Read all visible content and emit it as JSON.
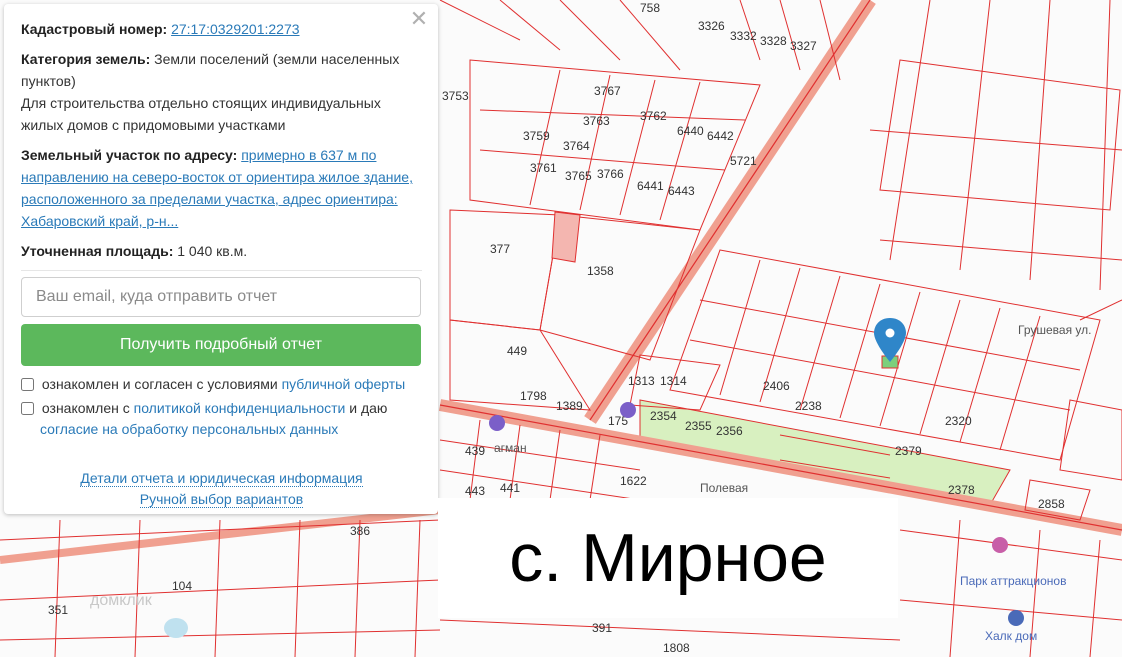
{
  "info_panel": {
    "cadastral_label": "Кадастровый номер:",
    "cadastral_number": "27:17:0329201:2273",
    "category_label": "Категория земель:",
    "category_value": "Земли поселений (земли населенных пунктов)",
    "usage": "Для строительства отдельно стоящих индивидуальных жилых домов с придомовыми участками",
    "address_label": "Земельный участок по адресу:",
    "address_link": "примерно в 637 м по направлению на северо-восток от ориентира жилое здание, расположенного за пределами участка, адрес ориентира: Хабаровский край, р-н...",
    "area_label": "Уточненная площадь:",
    "area_value": "1 040 кв.м.",
    "close_glyph": "✕"
  },
  "report_form": {
    "email_placeholder": "Ваш email, куда отправить отчет",
    "submit_label": "Получить подробный отчет",
    "consent1_text": "ознакомлен и согласен с условиями",
    "consent1_link": "публичной оферты",
    "consent2_text_a": "ознакомлен с",
    "consent2_link_a": "политикой конфиденциальности",
    "consent2_text_b": "и даю",
    "consent2_link_b": "согласие на обработку персональных данных"
  },
  "footer_links": {
    "details": "Детали отчета и юридическая информация",
    "manual": "Ручной выбор вариантов"
  },
  "caption": "с. Мирное",
  "map": {
    "parcel_labels": [
      "3759",
      "3767",
      "3763",
      "3762",
      "3764",
      "3761",
      "3765",
      "3766",
      "6440",
      "6442",
      "6441",
      "6443",
      "5721",
      "377",
      "1358",
      "449",
      "1313",
      "1314",
      "2406",
      "2238",
      "2320",
      "1798",
      "1389",
      "175",
      "2354",
      "2355",
      "2356",
      "2379",
      "2378",
      "2858",
      "439",
      "443",
      "441",
      "386",
      "104",
      "351",
      "391",
      "1808",
      "3326",
      "3332",
      "3328",
      "3327",
      "3753",
      "758",
      "1622"
    ],
    "street_labels": [
      "Грушевая ул.",
      "агман",
      "Полевая"
    ],
    "poi_labels": [
      "Парк аттракционов",
      "Халк дом"
    ],
    "watermark": "домклик",
    "colors": {
      "parcel_line": "#e03030",
      "road": "#f0a090",
      "highlight_area": "#d8f0c0",
      "pin": "#2f86c9",
      "button": "#5cb85c",
      "link": "#2a7ab8"
    }
  }
}
